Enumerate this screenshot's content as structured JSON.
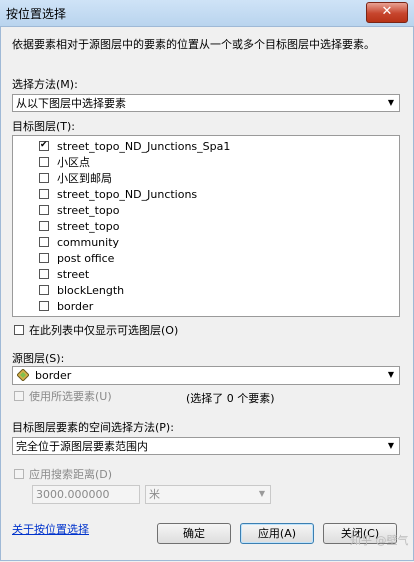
{
  "window": {
    "title": "按位置选择",
    "close": "✕"
  },
  "description": "依据要素相对于源图层中的要素的位置从一个或多个目标图层中选择要素。",
  "selection_method": {
    "label": "选择方法(M):",
    "value": "从以下图层中选择要素"
  },
  "target_layers": {
    "label": "目标图层(T):",
    "items": [
      {
        "label": "street_topo_ND_Junctions_Spa1",
        "checked": true
      },
      {
        "label": "小区点",
        "checked": false
      },
      {
        "label": "小区到邮局",
        "checked": false
      },
      {
        "label": "street_topo_ND_Junctions",
        "checked": false
      },
      {
        "label": "street_topo",
        "checked": false
      },
      {
        "label": "street_topo",
        "checked": false
      },
      {
        "label": "community",
        "checked": false
      },
      {
        "label": "post office",
        "checked": false
      },
      {
        "label": "street",
        "checked": false
      },
      {
        "label": "blockLength",
        "checked": false
      },
      {
        "label": "border",
        "checked": false
      }
    ]
  },
  "only_selectable": {
    "label": "在此列表中仅显示可选图层(O)",
    "checked": false
  },
  "source_layer": {
    "label": "源图层(S):",
    "value": "border"
  },
  "use_selected": {
    "label": "使用所选要素(U)",
    "checked": false,
    "selected_count": "(选择了 0 个要素)"
  },
  "spatial_method": {
    "label": "目标图层要素的空间选择方法(P):",
    "value": "完全位于源图层要素范围内"
  },
  "search_distance": {
    "label": "应用搜索距离(D)",
    "checked": false,
    "value": "3000.000000",
    "unit": "米"
  },
  "footer": {
    "help_link": "关于按位置选择",
    "ok": "确定",
    "apply": "应用(A)",
    "close": "关闭(C)",
    "watermark": "知乎 @壁气"
  },
  "icons": {
    "layer": "layer-diamond-icon",
    "dropdown": "triangle-down-icon",
    "check": "checkmark-icon"
  }
}
